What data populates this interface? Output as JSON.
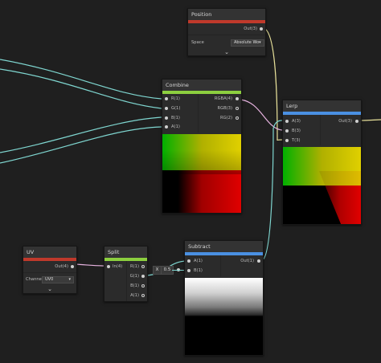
{
  "nodes": {
    "position": {
      "title": "Position",
      "accent": "#c0392b",
      "output": "Out(3)",
      "space_label": "Space",
      "space_value": "Absolute Wo▾"
    },
    "combine": {
      "title": "Combine",
      "accent": "#8ccf3f",
      "inputs": [
        "R(1)",
        "G(1)",
        "B(1)",
        "A(1)"
      ],
      "outputs": [
        "RGBA(4)",
        "RGB(3)",
        "RG(2)"
      ]
    },
    "lerp": {
      "title": "Lerp",
      "accent": "#4a90e2",
      "inputs": [
        "A(3)",
        "B(3)",
        "T(3)"
      ],
      "output": "Out(3)"
    },
    "uv": {
      "title": "UV",
      "accent": "#c0392b",
      "output": "Out(4)",
      "channel_label": "Channel",
      "channel_value": "UV0"
    },
    "split": {
      "title": "Split",
      "accent": "#8ccf3f",
      "input": "In(4)",
      "outputs": [
        "R(1)",
        "G(1)",
        "B(1)",
        "A(1)"
      ]
    },
    "subtract": {
      "title": "Subtract",
      "accent": "#4a90e2",
      "inputs": [
        "A(1)",
        "B(1)"
      ],
      "output": "Out(1)",
      "b_field_label": "X",
      "b_field_value": "0.5"
    }
  },
  "colors": {
    "wire_vec1": "#7fd6d0",
    "wire_vec3": "#e8e19a",
    "wire_vec4": "#e7b3e0",
    "background": "#1f1f1f"
  }
}
